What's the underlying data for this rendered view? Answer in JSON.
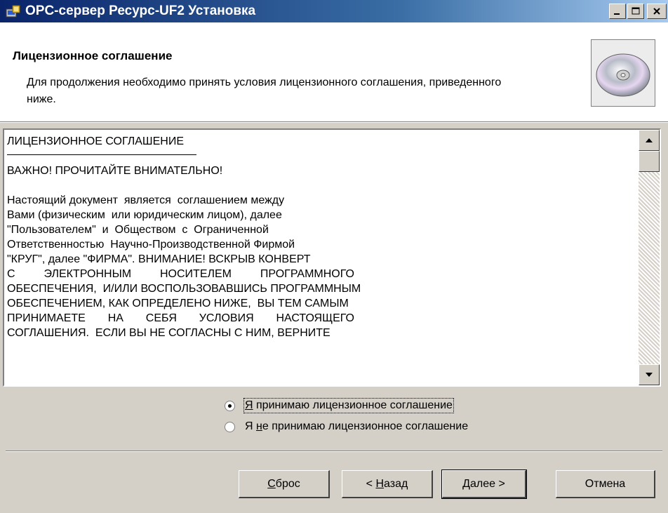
{
  "window": {
    "title": "OPC-сервер Ресурс-UF2 Установка",
    "icon": "installer-icon",
    "controls": [
      "minimize-icon",
      "maximize-icon",
      "close-icon"
    ]
  },
  "header": {
    "title": "Лицензионное соглашение",
    "description": "Для продолжения необходимо принять условия лицензионного соглашения, приведенного ниже.",
    "icon": "cd-disc-icon"
  },
  "license": {
    "heading": "ЛИЦЕНЗИОННОЕ СОГЛАШЕНИЕ",
    "important": "ВАЖНО! ПРОЧИТАЙТЕ ВНИМАТЕЛЬНО!",
    "body_lines": [
      "Настоящий документ  является  соглашением между",
      "Вами (физическим  или юридическим лицом), далее",
      "\"Пользователем\"  и  Обществом  с  Ограниченной",
      "Ответственностью  Научно-Производственной Фирмой",
      "\"КРУГ\", далее \"ФИРМА\". ВНИМАНИЕ! ВСКРЫВ КОНВЕРТ"
    ],
    "justified_lines": [
      [
        "С",
        "ЭЛЕКТРОННЫМ",
        "НОСИТЕЛЕМ",
        "ПРОГРАММНОГО"
      ]
    ],
    "body_lines_2": [
      "ОБЕСПЕЧЕНИЯ,  И/ИЛИ ВОСПОЛЬЗОВАВШИСЬ ПРОГРАММНЫМ",
      "ОБЕСПЕЧЕНИЕМ, КАК ОПРЕДЕЛЕНО НИЖЕ,  ВЫ ТЕМ САМЫМ"
    ],
    "justified_lines_2": [
      [
        "ПРИНИМАЕТЕ",
        "НА",
        "СЕБЯ",
        "УСЛОВИЯ",
        "НАСТОЯЩЕГО"
      ]
    ],
    "cut_line": "СОГЛАШЕНИЯ.  ЕСЛИ ВЫ НЕ СОГЛАСНЫ С НИМ, ВЕРНИТЕ"
  },
  "options": {
    "accept": {
      "mnemonic": "Я",
      "rest": " принимаю лицензионное соглашение",
      "selected": true
    },
    "decline": {
      "prefix": "Я ",
      "mnemonic": "н",
      "rest": "е принимаю лицензионное соглашение",
      "selected": false
    }
  },
  "buttons": {
    "reset": {
      "mnemonic": "С",
      "rest": "брос"
    },
    "back": {
      "prefix": "< ",
      "mnemonic": "Н",
      "rest": "азад"
    },
    "next": {
      "mnemonic": "Д",
      "rest": "алее >"
    },
    "cancel": {
      "label": "Отмена"
    }
  }
}
